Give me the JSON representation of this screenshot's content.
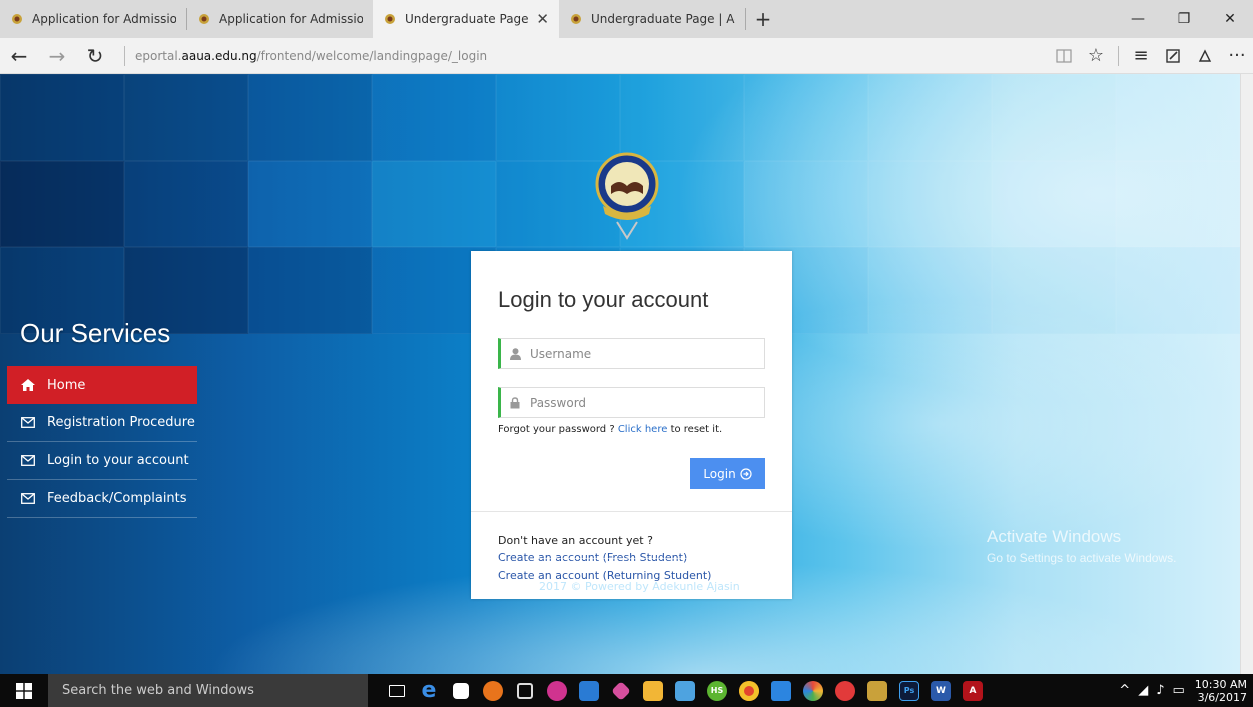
{
  "browser": {
    "tabs": [
      {
        "title": "Application for Admission in",
        "active": false
      },
      {
        "title": "Application for Admission in",
        "active": false
      },
      {
        "title": "Undergraduate Page | A",
        "active": true
      },
      {
        "title": "Undergraduate Page | Adeku",
        "active": false
      }
    ],
    "new_tab_label": "+",
    "url_prefix": "eportal.",
    "url_domain": "aaua.edu.ng",
    "url_path": "/frontend/welcome/landingpage/_login"
  },
  "sidebar": {
    "title": "Our Services",
    "items": [
      {
        "label": "Home",
        "active": true,
        "icon": "home-icon"
      },
      {
        "label": "Registration Procedure",
        "active": false,
        "icon": "envelope-icon"
      },
      {
        "label": "Login to your account",
        "active": false,
        "icon": "envelope-icon"
      },
      {
        "label": "Feedback/Complaints",
        "active": false,
        "icon": "envelope-icon"
      }
    ]
  },
  "login": {
    "title": "Login to your account",
    "username_placeholder": "Username",
    "password_placeholder": "Password",
    "forgot_text": "Forgot your password ?",
    "forgot_link": "Click here",
    "forgot_suffix": "to reset it.",
    "login_button": "Login",
    "no_account": "Don't have an account yet ?",
    "create_fresh": "Create an account (Fresh Student)",
    "create_returning": "Create an account (Returning Student)"
  },
  "footer": {
    "text": "2017 © Powered by Adekunle Ajasin"
  },
  "watermark": {
    "line1": "Activate Windows",
    "line2": "Go to Settings to activate Windows."
  },
  "taskbar": {
    "search_placeholder": "Search the web and Windows",
    "time": "10:30 AM",
    "date": "3/6/2017"
  },
  "colors": {
    "accent_red": "#d11f26",
    "login_blue": "#4c8ff0",
    "field_green": "#3ab54a",
    "link_blue": "#2a56a8"
  }
}
